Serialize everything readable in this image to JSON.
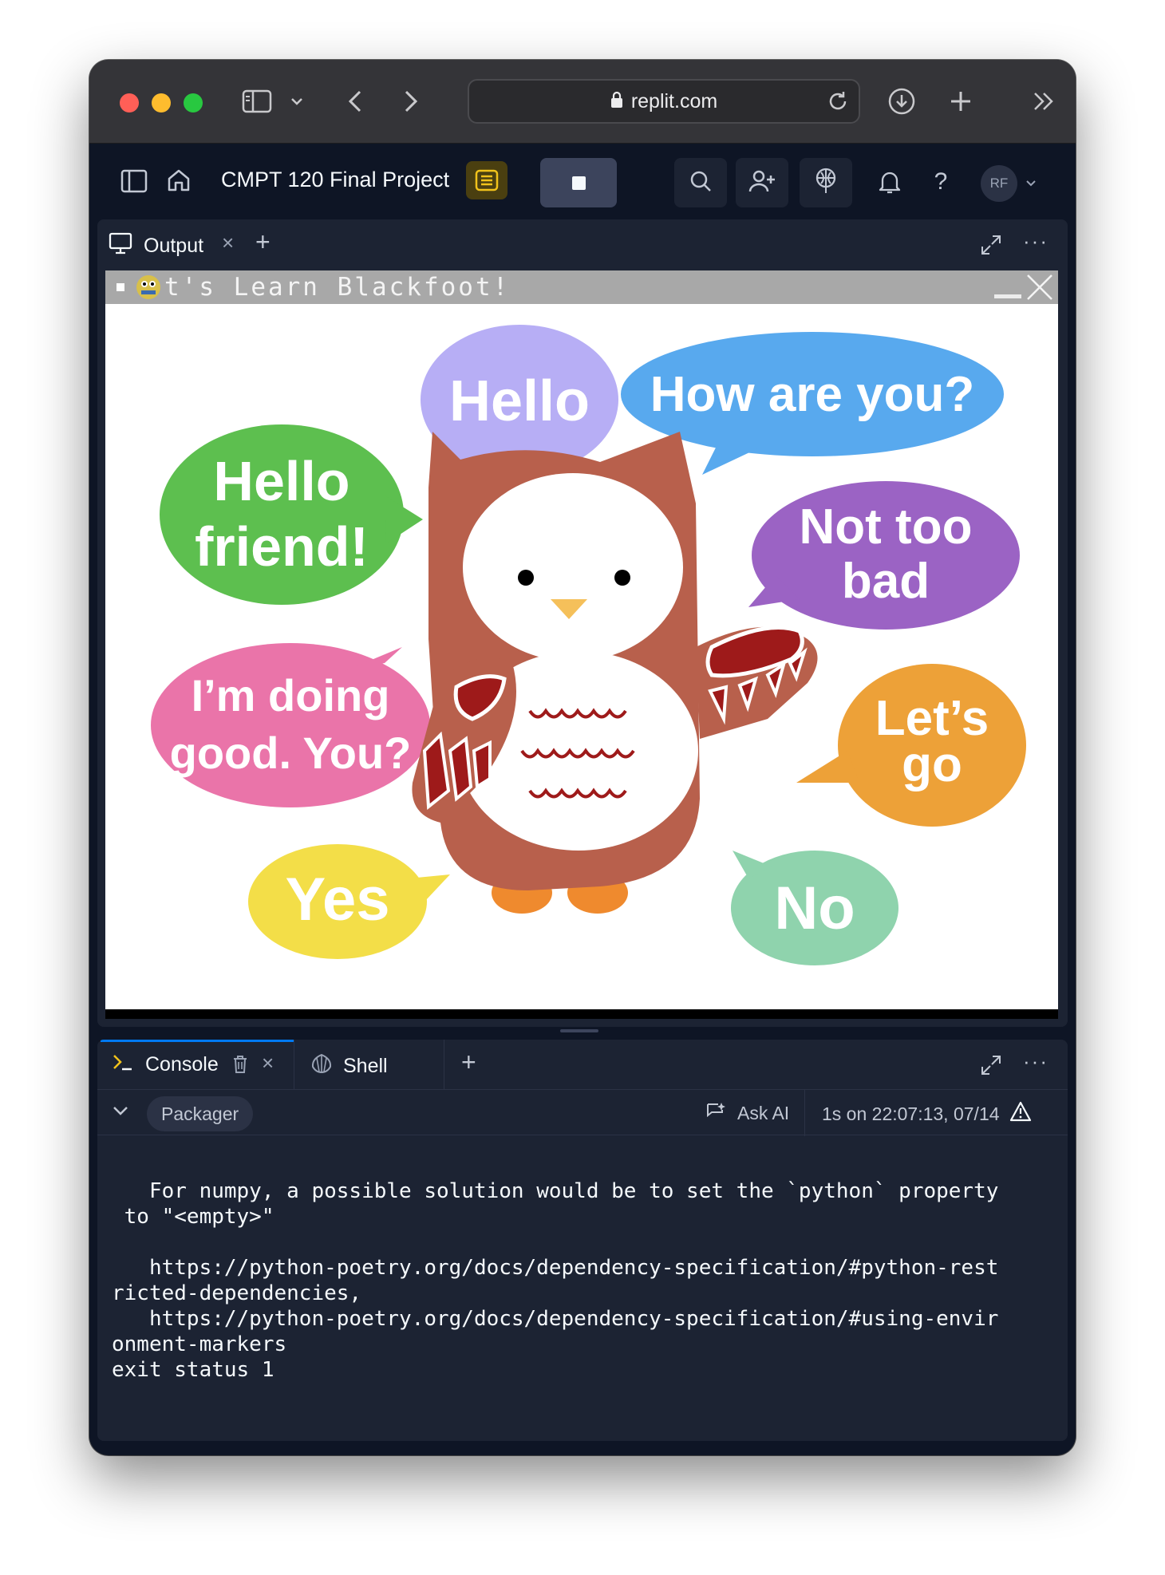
{
  "browser": {
    "url": "replit.com"
  },
  "header": {
    "project_title": "CMPT 120 Final Project",
    "avatar_initials": "RF"
  },
  "output_panel": {
    "tab_label": "Output"
  },
  "game_window": {
    "title": "Let's Learn Blackfoot!",
    "title_visible": "t's Learn Blackfoot!",
    "bubbles": [
      {
        "text1": "Hello",
        "text2": "",
        "color": "#b7aef5"
      },
      {
        "text1": "How are you?",
        "text2": "",
        "color": "#58a9ee"
      },
      {
        "text1": "Hello",
        "text2": "friend!",
        "color": "#5dbf4f"
      },
      {
        "text1": "Not too",
        "text2": "bad",
        "color": "#9b63c4"
      },
      {
        "text1": "I’m doing",
        "text2": "good. You?",
        "color": "#ea74a9"
      },
      {
        "text1": "Let’s",
        "text2": "go",
        "color": "#eda138"
      },
      {
        "text1": "Yes",
        "text2": "",
        "color": "#f3de48"
      },
      {
        "text1": "No",
        "text2": "",
        "color": "#8fd3ad"
      }
    ]
  },
  "console_panel": {
    "tabs": [
      {
        "label": "Console"
      },
      {
        "label": "Shell"
      }
    ],
    "packager_label": "Packager",
    "ask_ai_label": "Ask AI",
    "run_info": "1s on 22:07:13, 07/14",
    "output_lines": [
      "",
      "   For numpy, a possible solution would be to set the `python` property",
      " to \"<empty>\"",
      "",
      "   https://python-poetry.org/docs/dependency-specification/#python-rest",
      "ricted-dependencies,",
      "   https://python-poetry.org/docs/dependency-specification/#using-envir",
      "onment-markers",
      "exit status 1"
    ]
  },
  "colors": {
    "ide_bg": "#0e1525",
    "panel_bg": "#1c2333",
    "accent": "#0079f2",
    "owl_body": "#b8604c",
    "owl_wing_red": "#9e1a1a"
  }
}
